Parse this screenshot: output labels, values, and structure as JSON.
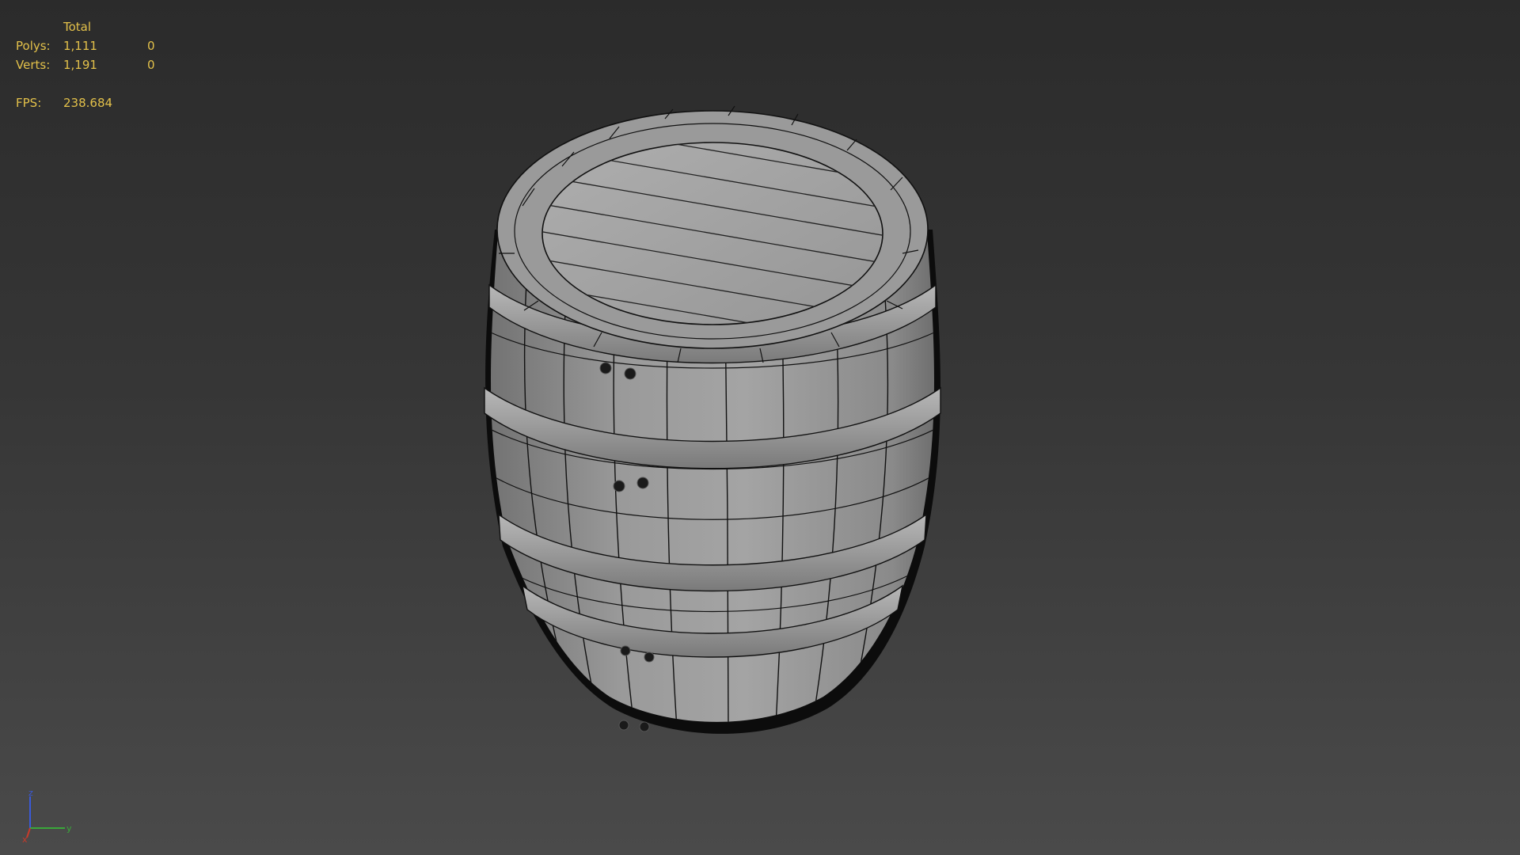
{
  "stats": {
    "total_header": "Total",
    "polys_label": "Polys:",
    "polys_total": "1,111",
    "polys_selected": "0",
    "verts_label": "Verts:",
    "verts_total": "1,191",
    "verts_selected": "0",
    "fps_label": "FPS:",
    "fps_value": "238.684"
  },
  "axis": {
    "z_label": "z",
    "y_label": "y",
    "x_label": "x"
  },
  "colors": {
    "stats_text": "#e3c14a",
    "axis_x": "#c83a2a",
    "axis_y": "#3aa83a",
    "axis_z": "#3a5ad8",
    "mesh_fill": "#8d8d8d",
    "wire": "#111111"
  },
  "viewport": {
    "object": "wooden-barrel-wireframe-mesh",
    "shading": "shaded-with-edged-faces"
  }
}
